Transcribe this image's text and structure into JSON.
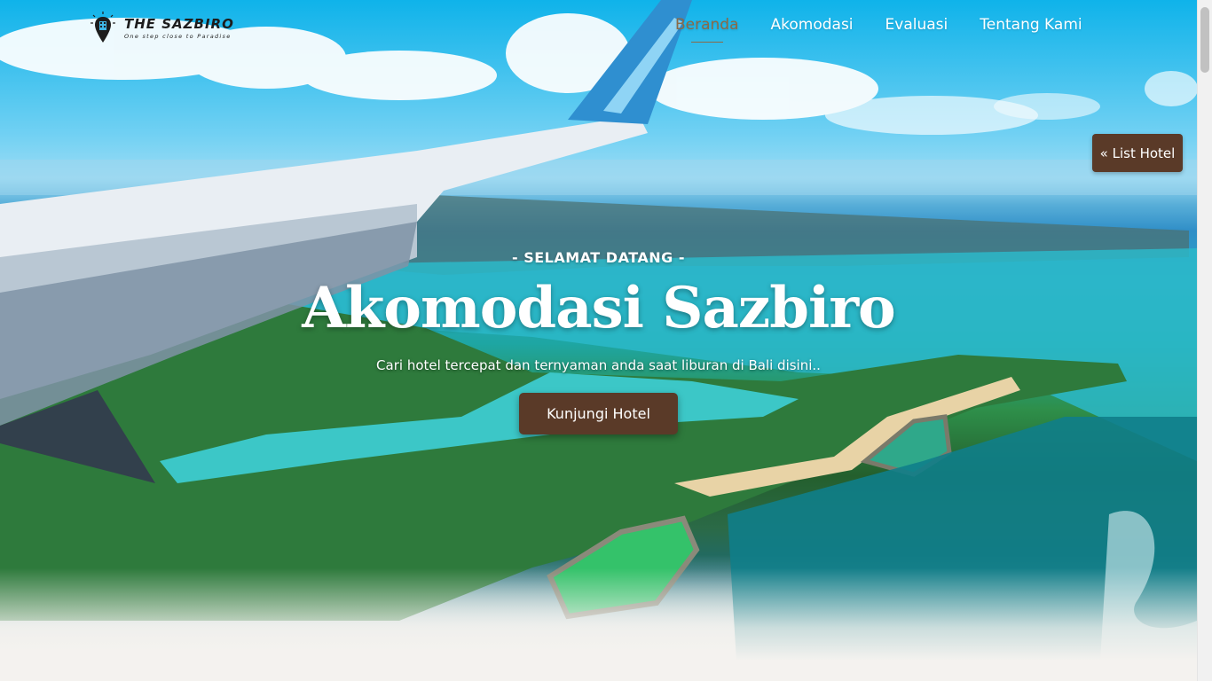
{
  "brand": {
    "name": "THE SAZBIRO",
    "tagline": "One step close to Paradise",
    "logo_icon": "map-pin-hotel-icon"
  },
  "nav": {
    "items": [
      {
        "label": "Beranda",
        "active": true
      },
      {
        "label": "Akomodasi",
        "active": false
      },
      {
        "label": "Evaluasi",
        "active": false
      },
      {
        "label": "Tentang Kami",
        "active": false
      }
    ]
  },
  "side_button": {
    "label": "« List Hotel"
  },
  "hero": {
    "welcome": "- SELAMAT DATANG -",
    "title": "Akomodasi Sazbiro",
    "subtitle": "Cari hotel tercepat dan ternyaman anda saat liburan di Bali disini..",
    "cta_label": "Kunjungi Hotel",
    "background": "airplane-wing-over-bali-coast-photo"
  },
  "colors": {
    "accent_brown": "#5a3a28",
    "nav_active": "#8a6a47",
    "page_bg": "#f4f2ef"
  }
}
